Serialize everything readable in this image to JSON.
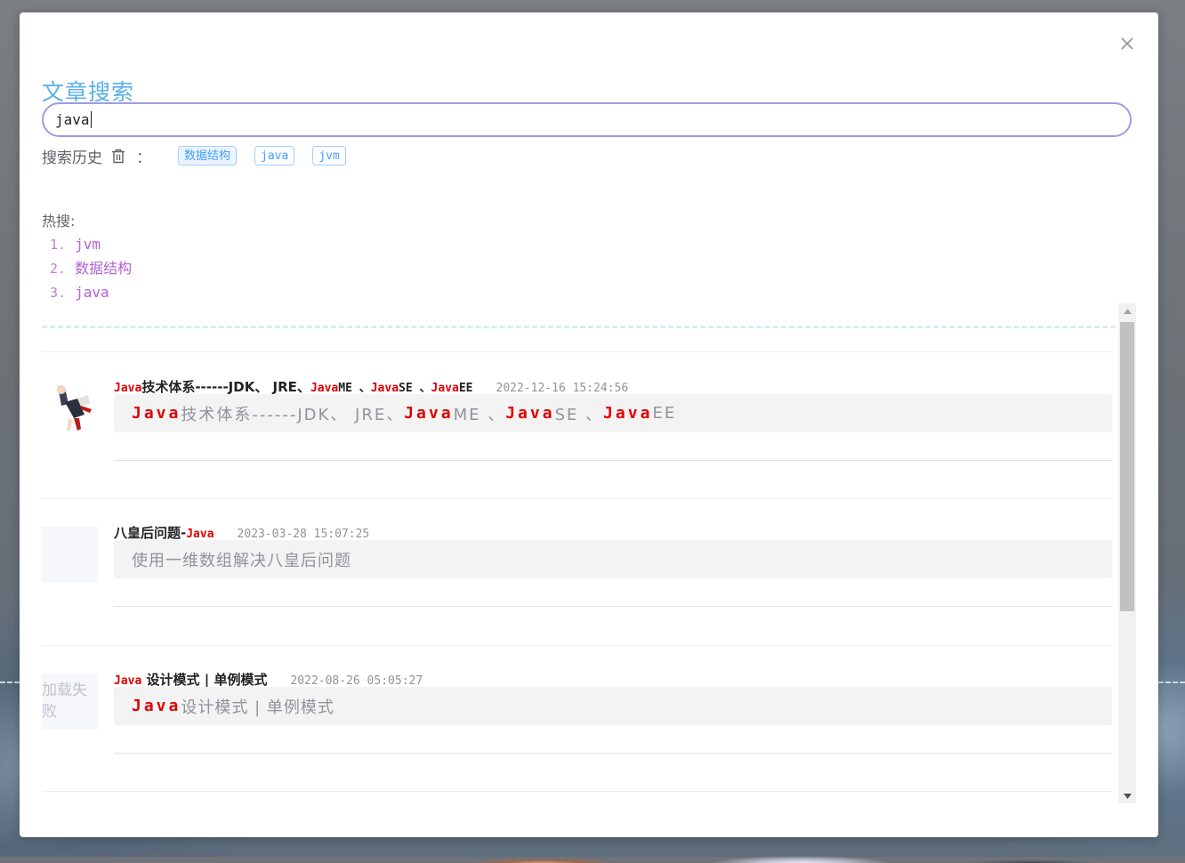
{
  "dialog": {
    "title": "文章搜索",
    "close_icon": "close-icon"
  },
  "search": {
    "value": "java"
  },
  "history": {
    "label": "搜索历史",
    "colon": "：",
    "tags": [
      "数据结构",
      "java",
      "jvm"
    ]
  },
  "hot": {
    "label": "热搜:",
    "items": [
      {
        "num": "1.",
        "text": "jvm"
      },
      {
        "num": "2.",
        "text": "数据结构"
      },
      {
        "num": "3.",
        "text": "java"
      }
    ]
  },
  "results": [
    {
      "title_parts": [
        "Java",
        "技术体系------JDK、 JRE、 ",
        "Java",
        " ME 、 ",
        "Java",
        " SE 、",
        "Java",
        " EE"
      ],
      "date": "2022-12-16 15:24:56",
      "summary_parts": [
        "Java",
        "技术体系------JDK、 JRE、",
        "Java",
        "ME 、",
        "Java",
        "SE 、",
        "Java",
        "EE"
      ],
      "thumb": "avatar-image"
    },
    {
      "title_parts": [
        "八皇后问题-",
        "Java"
      ],
      "date": "2023-03-28 15:07:25",
      "summary": "使用一维数组解决八皇后问题",
      "thumb": "blank-image"
    },
    {
      "title_parts": [
        "Java",
        " 设计模式 | 单例模式"
      ],
      "date": "2022-08-26 05:05:27",
      "summary_parts": [
        "Java",
        "设计模式 | 单例模式"
      ],
      "thumb_text": "加载失败"
    }
  ],
  "colors": {
    "title": "#58b1e6",
    "search_border": "#a29ae3",
    "highlight": "#e00000",
    "hot": "#b461d4",
    "tag": "#409eff"
  }
}
